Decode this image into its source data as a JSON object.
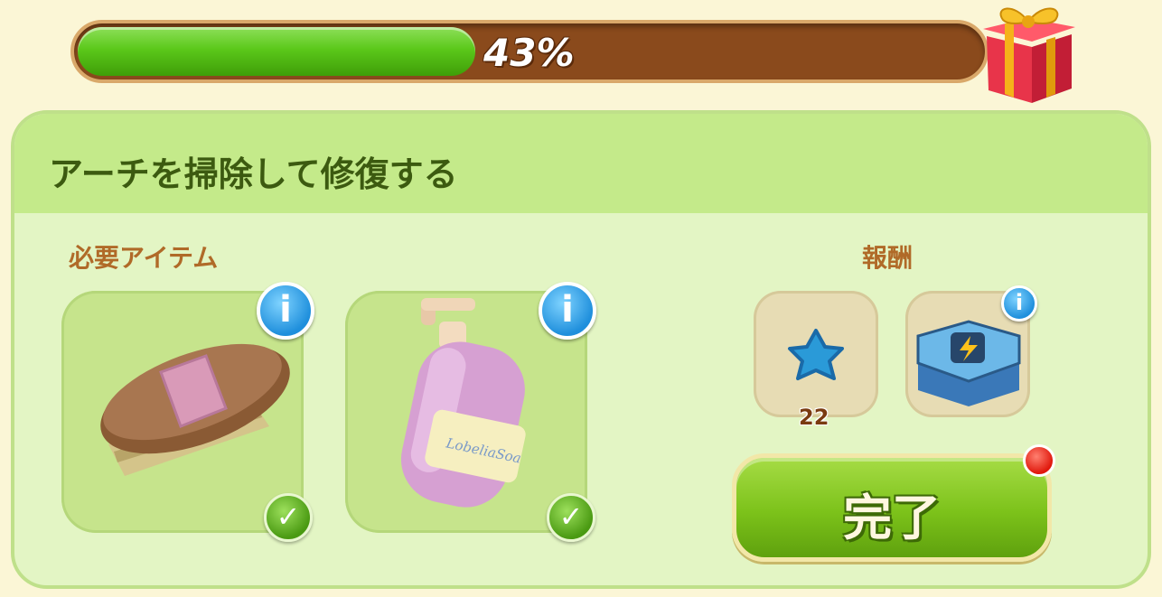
{
  "progress": {
    "value": 0.43,
    "label": "43%"
  },
  "panel": {
    "title": "アーチを掃除して修復する",
    "required_label": "必要アイテム",
    "reward_label": "報酬"
  },
  "required_items": [
    {
      "icon": "scrub-brush-icon",
      "status": "collected",
      "info": "i",
      "check": "✓"
    },
    {
      "icon": "soap-bottle-icon",
      "status": "collected",
      "info": "i",
      "check": "✓",
      "bottle_text": "LobeliaSoa"
    }
  ],
  "rewards": [
    {
      "icon": "blue-star-icon",
      "count": "22"
    },
    {
      "icon": "energy-chest-icon",
      "info": "i"
    }
  ],
  "complete_button": {
    "label": "完了",
    "has_notification": true
  },
  "colors": {
    "progress_fill": "#5bc81a",
    "progress_track": "#8a4a1c",
    "panel_bg": "#e3f5c4",
    "header_bg": "#c4ea8a",
    "title_text": "#3c5a10",
    "section_text": "#b06a28",
    "button_green": "#7cc21a"
  }
}
